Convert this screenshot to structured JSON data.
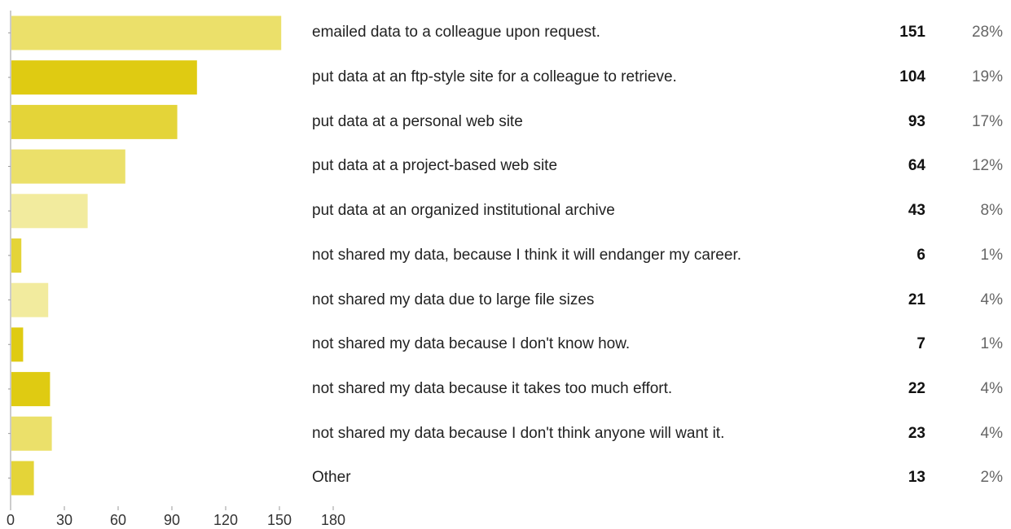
{
  "chart_data": {
    "type": "bar",
    "orientation": "horizontal",
    "categories": [
      "emailed data to a colleague upon request.",
      "put data at an ftp-style site for a colleague to retrieve.",
      "put data at a personal web site",
      "put data at a project-based web site",
      "put data at an organized institutional archive",
      "not shared my data, because I think it will endanger my career.",
      "not shared my data due to large file sizes",
      "not shared my data because I don't know how.",
      "not shared my data because it takes too much effort.",
      "not shared my data because I don't think anyone will want it.",
      "Other"
    ],
    "values": [
      151,
      104,
      93,
      64,
      43,
      6,
      21,
      7,
      22,
      23,
      13
    ],
    "count_labels": [
      "151",
      "104",
      "93",
      "64",
      "43",
      "6",
      "21",
      "7",
      "22",
      "23",
      "13"
    ],
    "percent_labels": [
      "28%",
      "19%",
      "17%",
      "12%",
      "8%",
      "1%",
      "4%",
      "1%",
      "4%",
      "4%",
      "2%"
    ],
    "bar_colors": [
      "#ebe06a",
      "#dfcb12",
      "#e4d438",
      "#ebe06a",
      "#f2eb9e",
      "#e4d438",
      "#f2eb9e",
      "#dfcb12",
      "#dfcb12",
      "#ebe06a",
      "#e4d438"
    ],
    "xlim": [
      0,
      180
    ],
    "xticks": [
      0,
      30,
      60,
      90,
      120,
      150,
      180
    ],
    "xtick_labels": [
      "0",
      "30",
      "60",
      "90",
      "120",
      "150",
      "180"
    ],
    "grid": false,
    "legend": "none",
    "axis_color": "#999999"
  }
}
